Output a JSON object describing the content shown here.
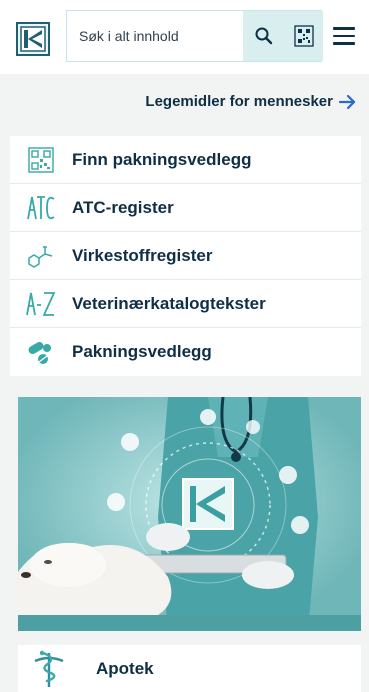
{
  "header": {
    "search_placeholder": "Søk i alt innhold",
    "accent_color": "#38a9a6",
    "search_button_bg": "#d9efef"
  },
  "human_link": {
    "label": "Legemidler for mennesker"
  },
  "menu": {
    "items": [
      {
        "label": "Finn pakningsvedlegg",
        "icon": "qr-code-icon"
      },
      {
        "label": "ATC-register",
        "icon": "atc-icon"
      },
      {
        "label": "Virkestoffregister",
        "icon": "molecule-icon"
      },
      {
        "label": "Veterinærkatalogtekster",
        "icon": "a-z-icon"
      },
      {
        "label": "Pakningsvedlegg",
        "icon": "pills-icon"
      }
    ]
  },
  "apotek": {
    "label": "Apotek",
    "icon": "pharmacy-snake-icon"
  }
}
